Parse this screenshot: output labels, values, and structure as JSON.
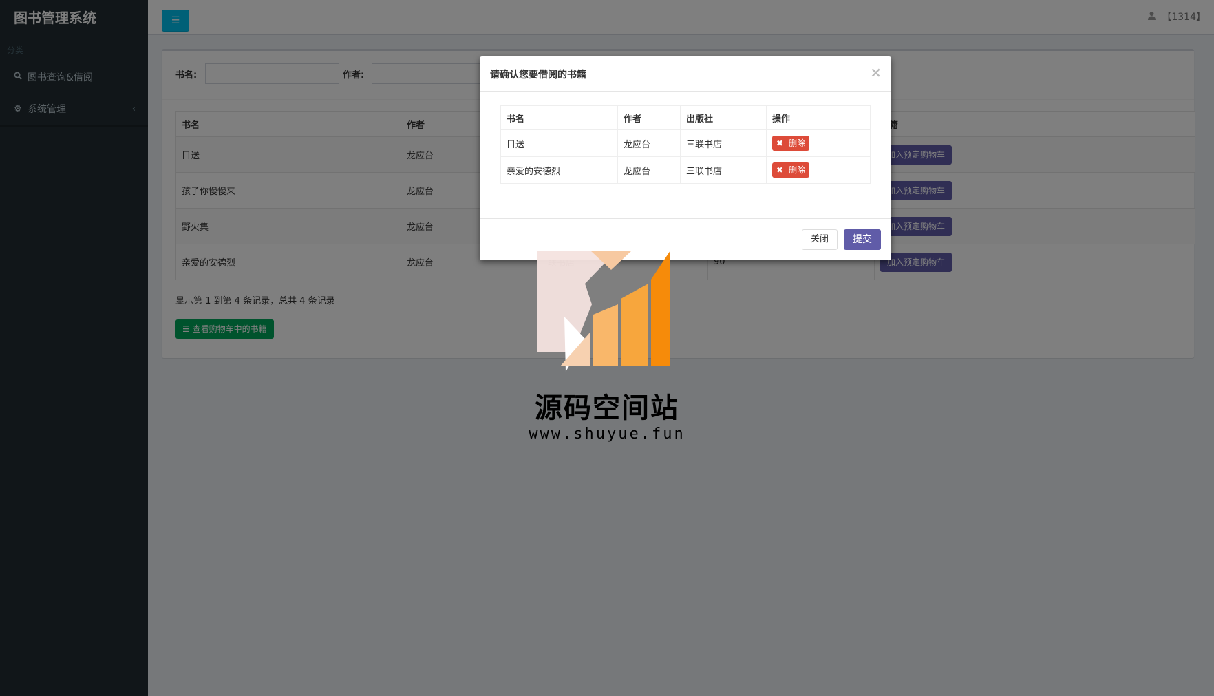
{
  "app": {
    "title": "图书管理系统"
  },
  "sidebar": {
    "header": "分类",
    "items": [
      {
        "label": "图书查询&借阅",
        "icon": "search-icon"
      },
      {
        "label": "系统管理",
        "icon": "gear-icon"
      }
    ]
  },
  "topbar": {
    "user": "【1314】"
  },
  "search": {
    "book_label": "书名:",
    "author_label": "作者:"
  },
  "book_table": {
    "headers": [
      "书名",
      "作者",
      "",
      "",
      "书籍"
    ],
    "rows": [
      {
        "title": "目送",
        "author": "龙应台",
        "publisher": "",
        "stock": "",
        "action": "加入预定购物车"
      },
      {
        "title": "孩子你慢慢来",
        "author": "龙应台",
        "publisher": "",
        "stock": "",
        "action": "加入预定购物车"
      },
      {
        "title": "野火集",
        "author": "龙应台",
        "publisher": "",
        "stock": "",
        "action": "加入预定购物车"
      },
      {
        "title": "亲爱的安德烈",
        "author": "龙应台",
        "publisher": "联书店",
        "stock": "90",
        "action": "加入预定购物车"
      }
    ]
  },
  "pagination": {
    "info": "显示第 1 到第 4 条记录，总共 4 条记录"
  },
  "cart_button": {
    "label": "查看购物车中的书籍"
  },
  "modal": {
    "title": "请确认您要借阅的书籍",
    "close_symbol": "×",
    "headers": [
      "书名",
      "作者",
      "出版社",
      "操作"
    ],
    "rows": [
      {
        "title": "目送",
        "author": "龙应台",
        "publisher": "三联书店",
        "action": "删除"
      },
      {
        "title": "亲爱的安德烈",
        "author": "龙应台",
        "publisher": "三联书店",
        "action": "删除"
      }
    ],
    "close_label": "关闭",
    "submit_label": "提交"
  },
  "watermark": {
    "title": "源码空间站",
    "url": "www.shuyue.fun"
  },
  "colors": {
    "sidebar_bg": "#222d32",
    "toggle_btn": "#00c0ef",
    "primary_purple": "#605ca8",
    "success_green": "#00a65a",
    "danger_red": "#dd4b39"
  }
}
